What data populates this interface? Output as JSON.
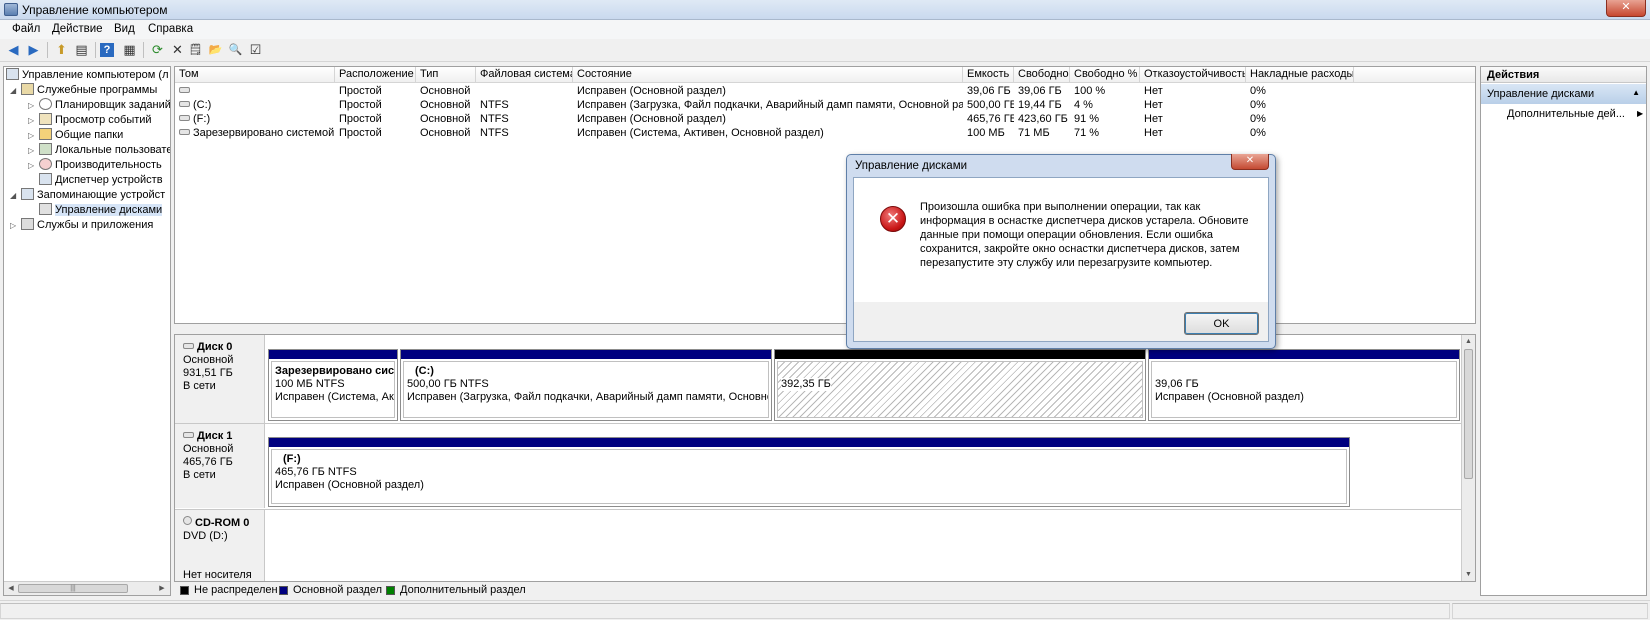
{
  "window": {
    "title": "Управление компьютером",
    "close_glyph": "✕"
  },
  "menu": [
    {
      "label": "Файл"
    },
    {
      "label": "Действие"
    },
    {
      "label": "Вид"
    },
    {
      "label": "Справка"
    }
  ],
  "toolbar": {
    "icons": [
      "back-arrow-icon",
      "forward-arrow-icon",
      "up-folder-icon",
      "show-hide-tree-icon",
      "help-icon",
      "properties-icon",
      "refresh-icon",
      "delete-icon",
      "properties-sheet-icon",
      "open-folder-icon",
      "search-icon",
      "check-settings-icon"
    ],
    "glyphs": {
      "back": "◀",
      "forward": "▶",
      "up": "⬆",
      "tree": "▤",
      "help": "?",
      "props": "▦",
      "refresh": "⟳",
      "delete": "✕",
      "sheet": "🗒",
      "folder": "📂",
      "search": "🔍",
      "check": "☑"
    }
  },
  "tree": {
    "items": [
      {
        "label": "Управление компьютером (л",
        "arrow": ""
      },
      {
        "label": "Служебные программы",
        "arrow": "◢"
      },
      {
        "label": "Планировщик заданий",
        "arrow": "▷"
      },
      {
        "label": "Просмотр событий",
        "arrow": "▷"
      },
      {
        "label": "Общие папки",
        "arrow": "▷"
      },
      {
        "label": "Локальные пользовате",
        "arrow": "▷"
      },
      {
        "label": "Производительность",
        "arrow": "▷"
      },
      {
        "label": "Диспетчер устройств",
        "arrow": ""
      },
      {
        "label": "Запоминающие устройст",
        "arrow": "◢"
      },
      {
        "label": "Управление дисками",
        "arrow": ""
      },
      {
        "label": "Службы и приложения",
        "arrow": "▷"
      }
    ],
    "scroll_left": "◀",
    "scroll_right": "▶",
    "scroll_grip": "|||"
  },
  "volumes": {
    "columns": [
      "Том",
      "Расположение",
      "Тип",
      "Файловая система",
      "Состояние",
      "Емкость",
      "Свободно",
      "Свободно %",
      "Отказоустойчивость",
      "Накладные расходы"
    ],
    "rows": [
      [
        "",
        "Простой",
        "Основной",
        "",
        "Исправен (Основной раздел)",
        "39,06 ГБ",
        "39,06 ГБ",
        "100 %",
        "Нет",
        "0%"
      ],
      [
        "(C:)",
        "Простой",
        "Основной",
        "NTFS",
        "Исправен (Загрузка, Файл подкачки, Аварийный дамп памяти, Основной раздел)",
        "500,00 ГБ",
        "19,44 ГБ",
        "4 %",
        "Нет",
        "0%"
      ],
      [
        "(F:)",
        "Простой",
        "Основной",
        "NTFS",
        "Исправен (Основной раздел)",
        "465,76 ГБ",
        "423,60 ГБ",
        "91 %",
        "Нет",
        "0%"
      ],
      [
        "Зарезервировано системой",
        "Простой",
        "Основной",
        "NTFS",
        "Исправен (Система, Активен, Основной раздел)",
        "100 МБ",
        "71 МБ",
        "71 %",
        "Нет",
        "0%"
      ]
    ]
  },
  "disks": {
    "disk0": {
      "name": "Диск 0",
      "type": "Основной",
      "size": "931,51 ГБ",
      "status": "В сети",
      "parts": [
        {
          "title": "Зарезервировано систе",
          "size": "100 МБ NTFS",
          "status": "Исправен (Система, Акт"
        },
        {
          "title": "(C:)",
          "size": "500,00 ГБ NTFS",
          "status": "Исправен (Загрузка, Файл подкачки, Аварийный дамп памяти, Основной р"
        },
        {
          "title": "",
          "size": "392,35 ГБ",
          "status": ""
        },
        {
          "title": "",
          "size": "39,06 ГБ",
          "status": "Исправен (Основной раздел)"
        }
      ]
    },
    "disk1": {
      "name": "Диск 1",
      "type": "Основной",
      "size": "465,76 ГБ",
      "status": "В сети",
      "parts": [
        {
          "title": "(F:)",
          "size": "465,76 ГБ NTFS",
          "status": "Исправен (Основной раздел)"
        }
      ]
    },
    "cdrom": {
      "name": "CD-ROM 0",
      "type": "DVD (D:)",
      "status": "Нет носителя"
    },
    "scroll_up": "▲",
    "scroll_down": "▼"
  },
  "legend": [
    {
      "label": "Не распределен",
      "color": "#000000"
    },
    {
      "label": "Основной раздел",
      "color": "#00007f"
    },
    {
      "label": "Дополнительный раздел",
      "color": "#008000"
    }
  ],
  "actions": {
    "header": "Действия",
    "section": "Управление дисками",
    "section_arrow": "▲",
    "item": "Дополнительные дей...",
    "item_arrow": "▶"
  },
  "dialog": {
    "title": "Управление дисками",
    "close_glyph": "✕",
    "icon_glyph": "✕",
    "message": "Произошла ошибка при выполнении операции, так как информация в оснастке диспетчера дисков устарела. Обновите данные при помощи операции обновления.  Если ошибка сохранится, закройте окно оснастки диспетчера дисков, затем перезапустите эту службу или перезагрузите компьютер.",
    "ok_label": "OK"
  }
}
